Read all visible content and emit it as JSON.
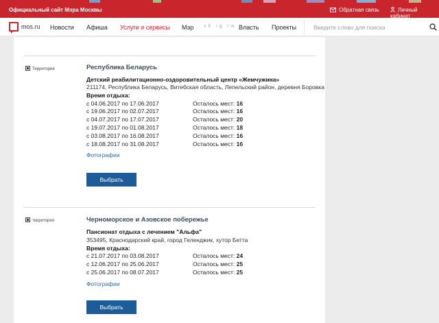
{
  "colors": {
    "brand_red": "#c8252c",
    "link_blue": "#2b6aa5",
    "button_blue": "#1d5c99"
  },
  "topbar": {
    "site_title": "Официальный сайт Мэра Москвы",
    "feedback": "Обратная связь",
    "cabinet": "Личный кабинет"
  },
  "nav": {
    "logo": "mos.ru",
    "items": [
      "Новости",
      "Афиша",
      "Услуги и сервисы",
      "Мэр",
      "Власть",
      "Проекты"
    ],
    "social": "vk ig tw",
    "search_placeholder": "Введите слово для поиска"
  },
  "entries": [
    {
      "tag": "Территория",
      "region": "Республика Беларусь",
      "camp": "Детский реабилитационно-оздоровительный центр «Жемчужина»",
      "address": "211174, Республика Беларусь, Витебская область, Лепельский район, деревня Боровка",
      "rest_label": "Время отдыха:",
      "sessions": [
        {
          "period": "с 04.06.2017 по 17.06.2017",
          "left_label": "Осталось мест:",
          "left": "16"
        },
        {
          "period": "с 19.06.2017 по 02.07.2017",
          "left_label": "Осталось мест:",
          "left": "16"
        },
        {
          "period": "с 04.07.2017 по 17.07.2017",
          "left_label": "Осталось мест:",
          "left": "20"
        },
        {
          "period": "с 19.07.2017 по 01.08.2017",
          "left_label": "Осталось мест:",
          "left": "18"
        },
        {
          "period": "с 03.08.2017 по 16.08.2017",
          "left_label": "Осталось мест:",
          "left": "16"
        },
        {
          "period": "с 18.08.2017 по 31.08.2017",
          "left_label": "Осталось мест:",
          "left": "16"
        }
      ],
      "photos": "Фотографии",
      "button": "Выбрать"
    },
    {
      "tag": "территория",
      "region": "Черноморское и Азовское побережье",
      "camp": "Пансионат отдыха с лечением \"Альфа\"",
      "address": "353495, Краснодарский край, город Геленджик, хутор Бетта",
      "rest_label": "Время отдыха:",
      "sessions": [
        {
          "period": "с 21.07.2017 по 03.08.2017",
          "left_label": "Осталось мест:",
          "left": "24"
        },
        {
          "period": "с 12.06.2017 по 25.06.2017",
          "left_label": "Осталось мест:",
          "left": "25"
        },
        {
          "period": "с 25.06.2017 по 08.07.2017",
          "left_label": "Осталось мест:",
          "left": "25"
        }
      ],
      "photos": "Фотографии",
      "button": "Выбрать"
    }
  ]
}
